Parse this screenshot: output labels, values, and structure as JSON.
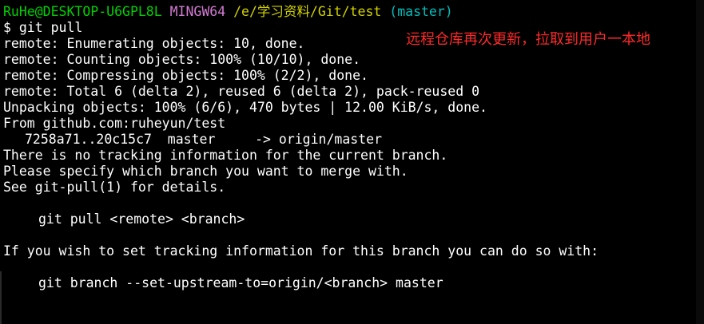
{
  "prompt": {
    "user_host": "RuHe@DESKTOP-U6GPL8L",
    "shell": "MINGW64",
    "path": "/e/学习资料/Git/test",
    "branch": "(master)"
  },
  "command": "$ git pull",
  "output": [
    "remote: Enumerating objects: 10, done.",
    "remote: Counting objects: 100% (10/10), done.",
    "remote: Compressing objects: 100% (2/2), done.",
    "remote: Total 6 (delta 2), reused 6 (delta 2), pack-reused 0",
    "Unpacking objects: 100% (6/6), 470 bytes | 12.00 KiB/s, done.",
    "From github.com:ruheyun/test",
    "7258a71..20c15c7  master     -> origin/master",
    "There is no tracking information for the current branch.",
    "Please specify which branch you want to merge with.",
    "See git-pull(1) for details.",
    "",
    "git pull <remote> <branch>",
    "",
    "If you wish to set tracking information for this branch you can do so with:",
    "",
    "git branch --set-upstream-to=origin/<branch> master"
  ],
  "annotation": "远程仓库再次更新，拉取到用户一本地",
  "colors": {
    "background": "#000000",
    "text": "#ffffff",
    "user_host": "#00d200",
    "shell": "#d27bd2",
    "path": "#d2d200",
    "branch": "#00bebe",
    "annotation": "#ff2a2a"
  }
}
